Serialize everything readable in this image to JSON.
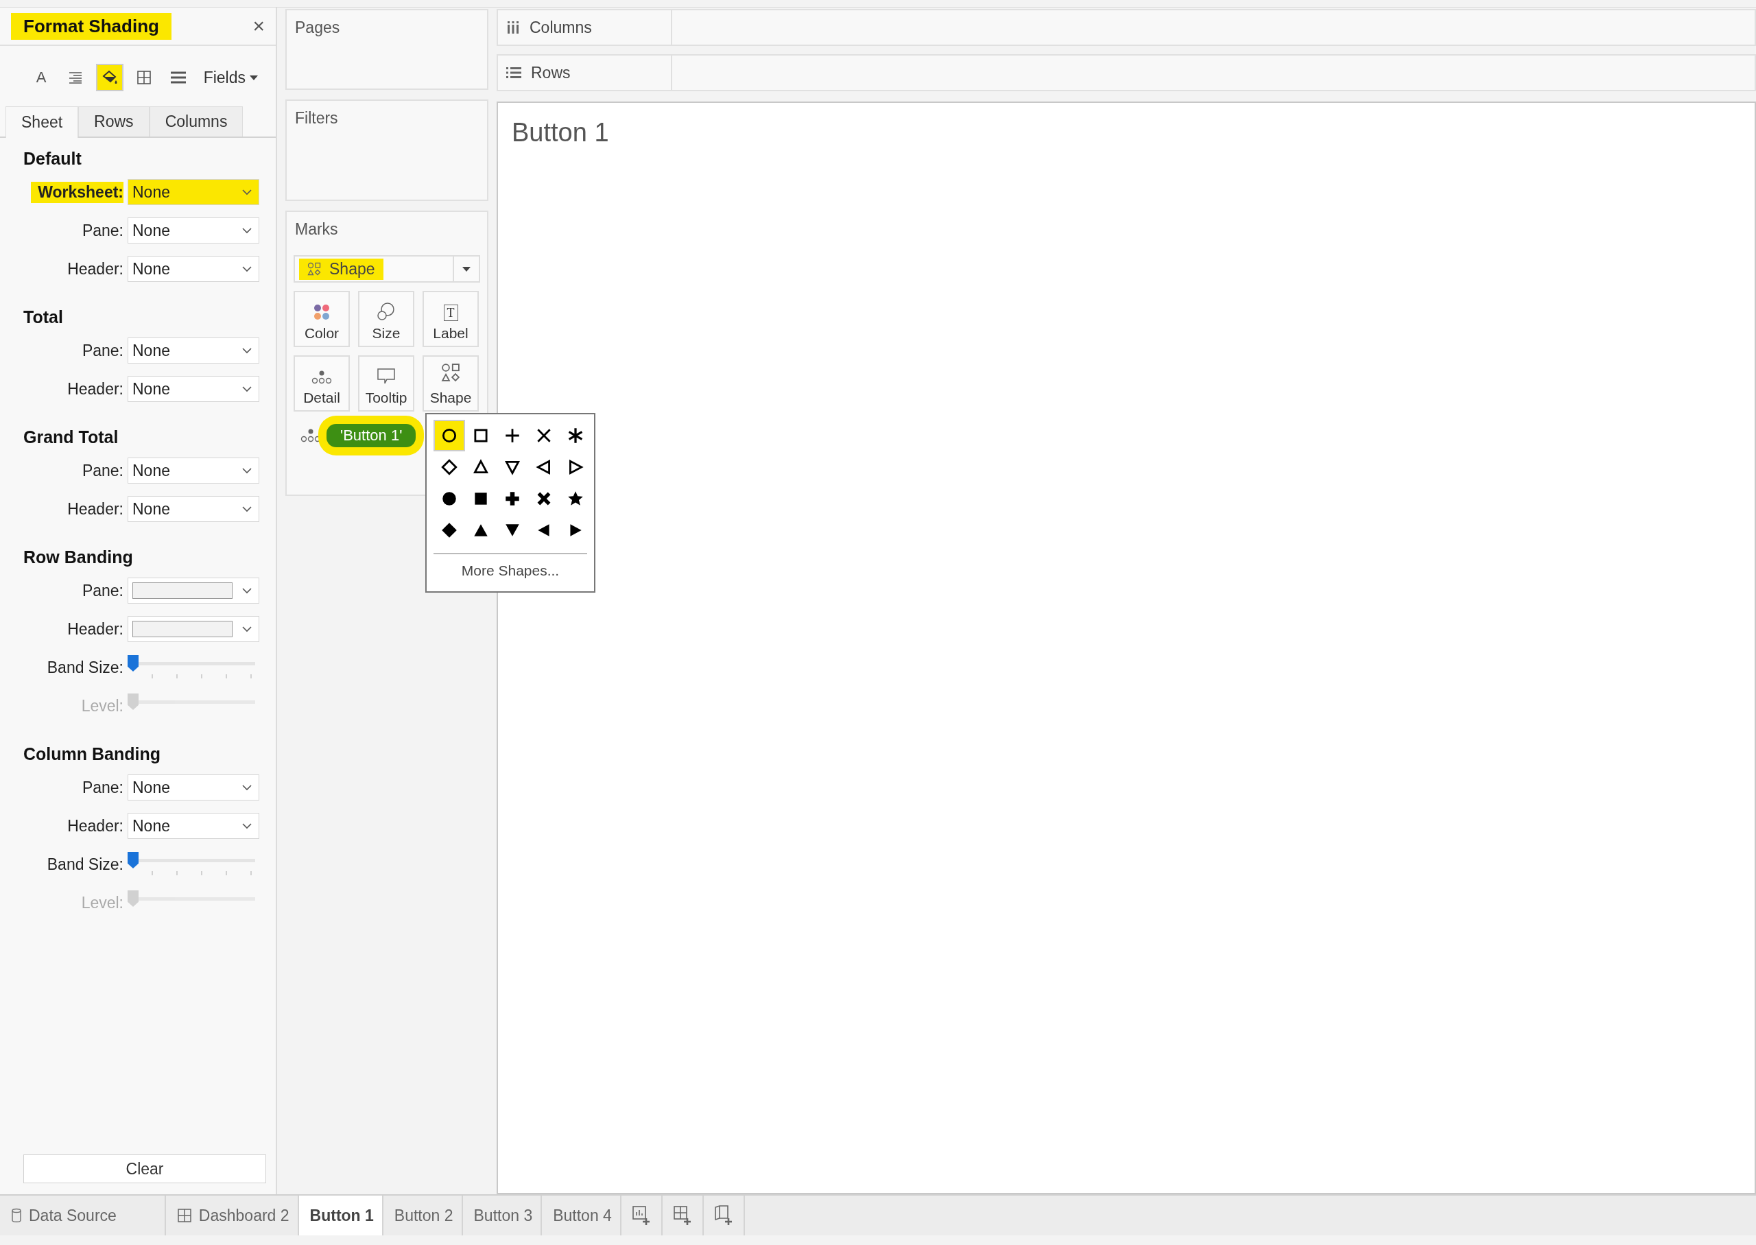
{
  "format_panel": {
    "title": "Format Shading",
    "title_highlighted": true,
    "close": "×",
    "toolbar": [
      {
        "glyph": "A",
        "selected": false,
        "highlighted": false
      },
      {
        "selected": false,
        "highlighted": false
      },
      {
        "selected": true,
        "highlighted": true
      },
      {
        "selected": false,
        "highlighted": false
      },
      {
        "selected": false,
        "highlighted": false
      }
    ],
    "fields_menu": "Fields",
    "tabs": [
      {
        "label": "Sheet",
        "selected": true
      },
      {
        "label": "Rows",
        "selected": false
      },
      {
        "label": "Columns",
        "selected": false
      }
    ],
    "sections": [
      {
        "title": "Default",
        "rows": [
          {
            "kind": "dropdown",
            "label": "Worksheet:",
            "value": "None",
            "highlighted": true
          },
          {
            "kind": "dropdown",
            "label": "Pane:",
            "value": "None",
            "highlighted": false
          },
          {
            "kind": "dropdown",
            "label": "Header:",
            "value": "None",
            "highlighted": false
          }
        ]
      },
      {
        "title": "Total",
        "rows": [
          {
            "kind": "dropdown",
            "label": "Pane:",
            "value": "None",
            "highlighted": false
          },
          {
            "kind": "dropdown",
            "label": "Header:",
            "value": "None",
            "highlighted": false
          }
        ]
      },
      {
        "title": "Grand Total",
        "rows": [
          {
            "kind": "dropdown",
            "label": "Pane:",
            "value": "None",
            "highlighted": false
          },
          {
            "kind": "dropdown",
            "label": "Header:",
            "value": "None",
            "highlighted": false
          }
        ]
      },
      {
        "title": "Row Banding",
        "rows": [
          {
            "kind": "swatch",
            "label": "Pane:"
          },
          {
            "kind": "swatch",
            "label": "Header:"
          },
          {
            "kind": "slider",
            "label": "Band Size:",
            "level": 0,
            "disabled": false
          },
          {
            "kind": "slider",
            "label": "Level:",
            "level": 0,
            "disabled": true
          }
        ]
      },
      {
        "title": "Column Banding",
        "rows": [
          {
            "kind": "dropdown",
            "label": "Pane:",
            "value": "None",
            "highlighted": false
          },
          {
            "kind": "dropdown",
            "label": "Header:",
            "value": "None",
            "highlighted": false
          },
          {
            "kind": "slider",
            "label": "Band Size:",
            "level": 0,
            "disabled": false
          },
          {
            "kind": "slider",
            "label": "Level:",
            "level": 0,
            "disabled": true
          }
        ]
      }
    ],
    "clear_button": "Clear"
  },
  "cards": {
    "pages": "Pages",
    "filters": "Filters",
    "marks": {
      "title": "Marks",
      "mark_type": "Shape",
      "mark_type_highlighted": true,
      "buttons": [
        {
          "label": "Color"
        },
        {
          "label": "Size"
        },
        {
          "label": "Label",
          "glyph": "T"
        },
        {
          "label": "Detail"
        },
        {
          "label": "Tooltip"
        },
        {
          "label": "Shape"
        }
      ],
      "pill": {
        "label": "'Button 1'",
        "highlighted": true
      }
    }
  },
  "shape_palette": {
    "shapes": [
      {
        "selected": true,
        "highlighted": true
      },
      {
        "selected": false
      },
      {
        "selected": false
      },
      {
        "selected": false
      },
      {
        "selected": false
      },
      {
        "selected": false
      },
      {
        "selected": false
      },
      {
        "selected": false
      },
      {
        "selected": false
      },
      {
        "selected": false
      },
      {
        "selected": false
      },
      {
        "selected": false
      },
      {
        "selected": false
      },
      {
        "selected": false
      },
      {
        "selected": false
      },
      {
        "selected": false
      },
      {
        "selected": false
      },
      {
        "selected": false
      },
      {
        "selected": false
      },
      {
        "selected": false
      }
    ],
    "more": "More Shapes..."
  },
  "shelves": [
    {
      "label": "Columns"
    },
    {
      "label": "Rows"
    }
  ],
  "view": {
    "title": "Button 1"
  },
  "sheet_tabs": [
    {
      "label": "Data Source",
      "selected": false
    },
    {
      "label": "Dashboard 2",
      "selected": false
    },
    {
      "label": "Button 1",
      "selected": true
    },
    {
      "label": "Button 2",
      "selected": false
    },
    {
      "label": "Button 3",
      "selected": false
    },
    {
      "label": "Button 4",
      "selected": false
    }
  ]
}
